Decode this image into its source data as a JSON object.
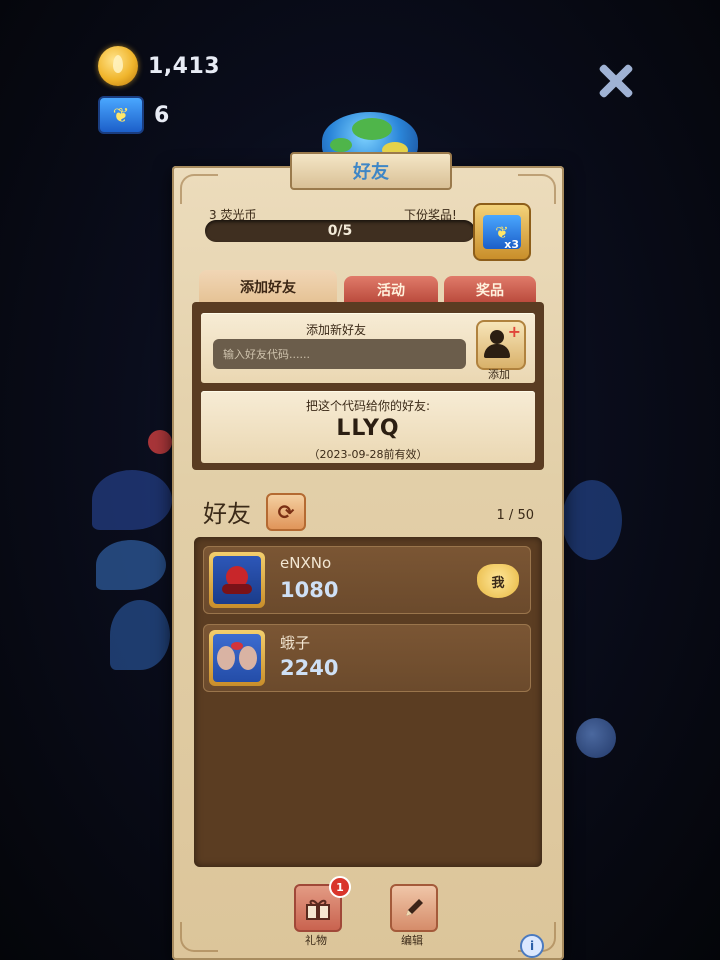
{
  "hud": {
    "coins": "1,413",
    "butterflies": "6"
  },
  "panel": {
    "title": "好友"
  },
  "reward": {
    "left_label": "3 荧光币",
    "right_label": "下份奖品!",
    "progress_text": "0/5",
    "progress_fraction": 0,
    "multiplier": "x3"
  },
  "tabs": [
    {
      "label": "添加好友",
      "active": true
    },
    {
      "label": "活动",
      "active": false
    },
    {
      "label": "奖品",
      "active": false
    }
  ],
  "add_friend": {
    "title": "添加新好友",
    "input_placeholder": "输入好友代码......",
    "add_button_label": "添加"
  },
  "share_code": {
    "instruction": "把这个代码给你的好友:",
    "code": "LLYQ",
    "expiry": "（2023-09-28前有效）"
  },
  "friends": {
    "heading": "好友",
    "count": "1 / 50",
    "list": [
      {
        "name": "eNXNo",
        "score": "1080",
        "is_me": true,
        "me_label": "我"
      },
      {
        "name": "蛾子",
        "score": "2240",
        "is_me": false
      }
    ]
  },
  "bottom": {
    "gift_label": "礼物",
    "gift_badge": "1",
    "edit_label": "编辑",
    "info_label": "i"
  },
  "icons": {
    "coin": "coin-icon",
    "butterfly": "butterfly-icon",
    "close": "close-icon",
    "refresh": "refresh-icon",
    "add_friend": "add-friend-icon",
    "gift": "gift-icon",
    "edit": "pencil-icon"
  },
  "colors": {
    "panel_bg": "#e2cfa8",
    "tab_inactive": "#c95a48",
    "list_bg": "#5b3d22",
    "accent_blue": "#3e86c6"
  }
}
